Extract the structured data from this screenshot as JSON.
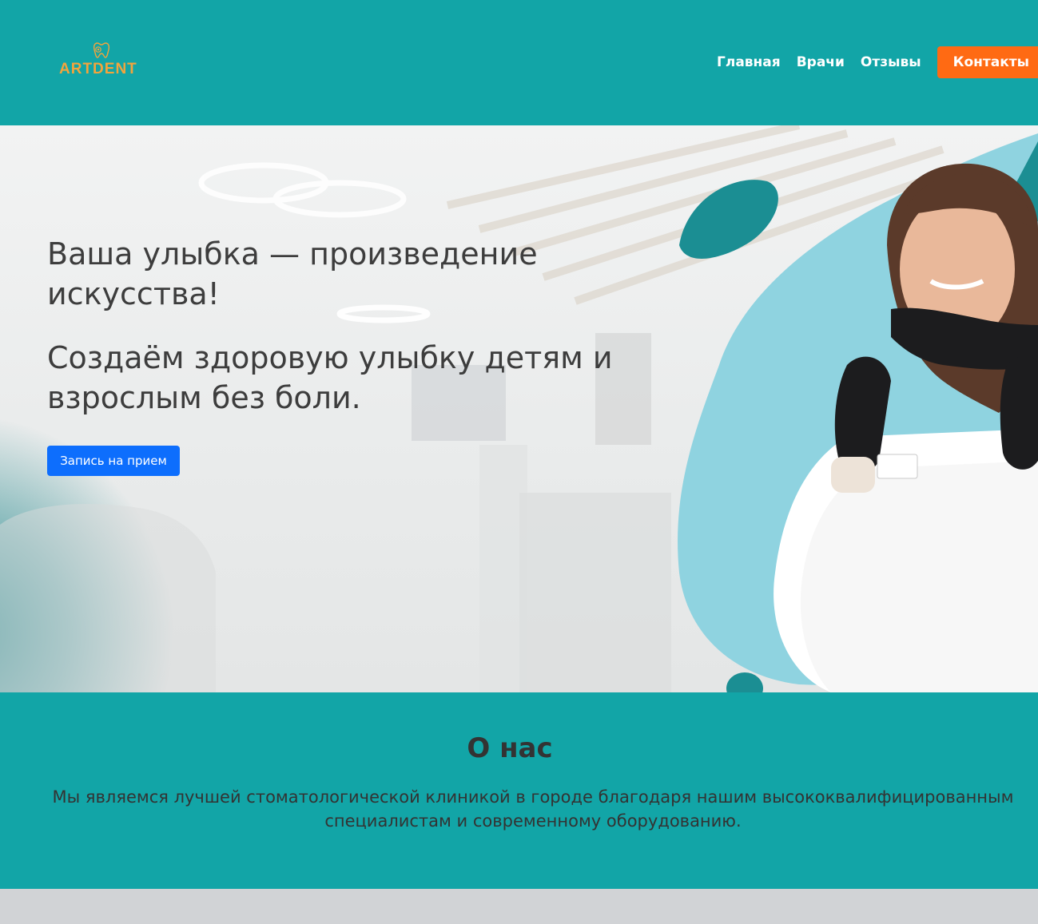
{
  "header": {
    "logo_text": "ARTDENT",
    "nav": [
      {
        "label": "Главная"
      },
      {
        "label": "Врачи"
      },
      {
        "label": "Отзывы"
      }
    ],
    "contact_label": "Контакты"
  },
  "hero": {
    "title": "Ваша улыбка — произведение искусства!",
    "subtitle": "Создаём здоровую улыбку детям и взрослым без боли.",
    "cta_label": "Запись на прием"
  },
  "about": {
    "title": "О нас",
    "text": "Мы являемся лучшей стоматологической клиникой в городе благодаря нашим высококвалифицированным специалистам и современному оборудованию."
  },
  "colors": {
    "header_bg": "#12a5a7",
    "accent_orange": "#ff6a13",
    "cta_blue": "#0d6efd",
    "logo_gold": "#f3a43c",
    "shape_dark_teal": "#1b8e93",
    "shape_light_blue": "#8fd3e0"
  }
}
